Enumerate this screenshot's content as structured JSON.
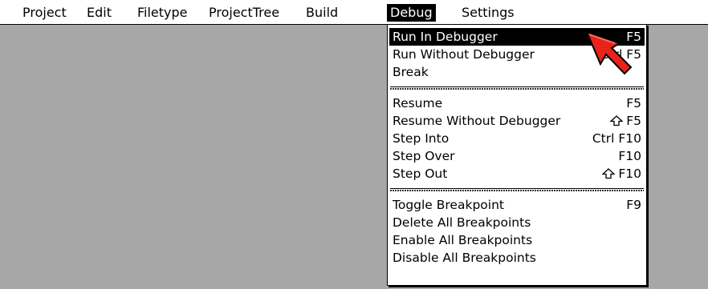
{
  "menubar": {
    "items": [
      {
        "label": "Project"
      },
      {
        "label": "Edit"
      },
      {
        "label": "Filetype"
      },
      {
        "label": "ProjectTree"
      },
      {
        "label": "Build"
      },
      {
        "label": "Debug"
      },
      {
        "label": "Settings"
      }
    ],
    "active": "Debug"
  },
  "debug_menu": {
    "items": [
      {
        "label": "Run In Debugger",
        "shortcut": "F5",
        "highlighted": true
      },
      {
        "label": "Run Without Debugger",
        "shortcut": "Ctrl F5"
      },
      {
        "label": "Break",
        "shortcut": ""
      },
      {
        "label": "Resume",
        "shortcut": "F5"
      },
      {
        "label": "Resume Without Debugger",
        "shortcut": "F5",
        "shortcut_modifier_icon": "shift-icon"
      },
      {
        "label": "Step Into",
        "shortcut": "Ctrl F10"
      },
      {
        "label": "Step Over",
        "shortcut": "F10"
      },
      {
        "label": "Step Out",
        "shortcut": "F10",
        "shortcut_modifier_icon": "shift-icon"
      },
      {
        "label": "Toggle Breakpoint",
        "shortcut": "F9"
      },
      {
        "label": "Delete All Breakpoints",
        "shortcut": ""
      },
      {
        "label": "Enable All Breakpoints",
        "shortcut": ""
      },
      {
        "label": "Disable All Breakpoints",
        "shortcut": ""
      }
    ]
  },
  "colors": {
    "desktop_background": "#a7a7a7",
    "cursor": "#e8231b"
  },
  "icons": {
    "pointer": "mouse-pointer-icon",
    "modifier": "shift-icon"
  }
}
